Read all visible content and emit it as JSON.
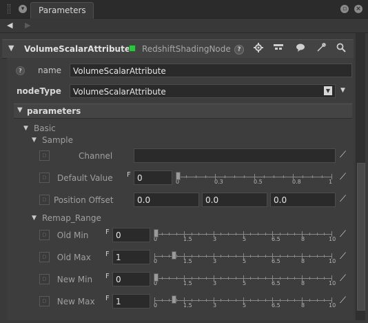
{
  "panel": {
    "tab_label": "Parameters"
  },
  "node": {
    "title": "VolumeScalarAttribute",
    "type": "RedshiftShadingNode",
    "status_color": "#2fc243"
  },
  "fields": {
    "name_label": "name",
    "name_value": "VolumeScalarAttribute",
    "nodetype_label": "nodeType",
    "nodetype_value": "VolumeScalarAttribute"
  },
  "sections": {
    "parameters": "parameters",
    "basic": "Basic",
    "sample": "Sample",
    "remap": "Remap_Range"
  },
  "sample": {
    "channel_label": "Channel",
    "channel_value": "",
    "default_label": "Default Value",
    "default_value": "0",
    "default_fraction": 0,
    "default_ticks": [
      "0",
      "0.3",
      "0.5",
      "0.8",
      "1"
    ],
    "offset_label": "Position Offset",
    "offset_values": [
      "0.0",
      "0.0",
      "0.0"
    ]
  },
  "remap": {
    "ticks": [
      "0",
      "1.5",
      "3",
      "5",
      "6.5",
      "8",
      "10"
    ],
    "rows": [
      {
        "label": "Old Min",
        "value": "0",
        "fraction": 0
      },
      {
        "label": "Old Max",
        "value": "1",
        "fraction": 0.1
      },
      {
        "label": "New Min",
        "value": "0",
        "fraction": 0
      },
      {
        "label": "New Max",
        "value": "1",
        "fraction": 0.1
      }
    ]
  },
  "glyphs": {
    "key": "F",
    "d": "D",
    "help": "?",
    "expand": "▼",
    "left": "◀",
    "right": "▶",
    "dropdown": "▼"
  }
}
